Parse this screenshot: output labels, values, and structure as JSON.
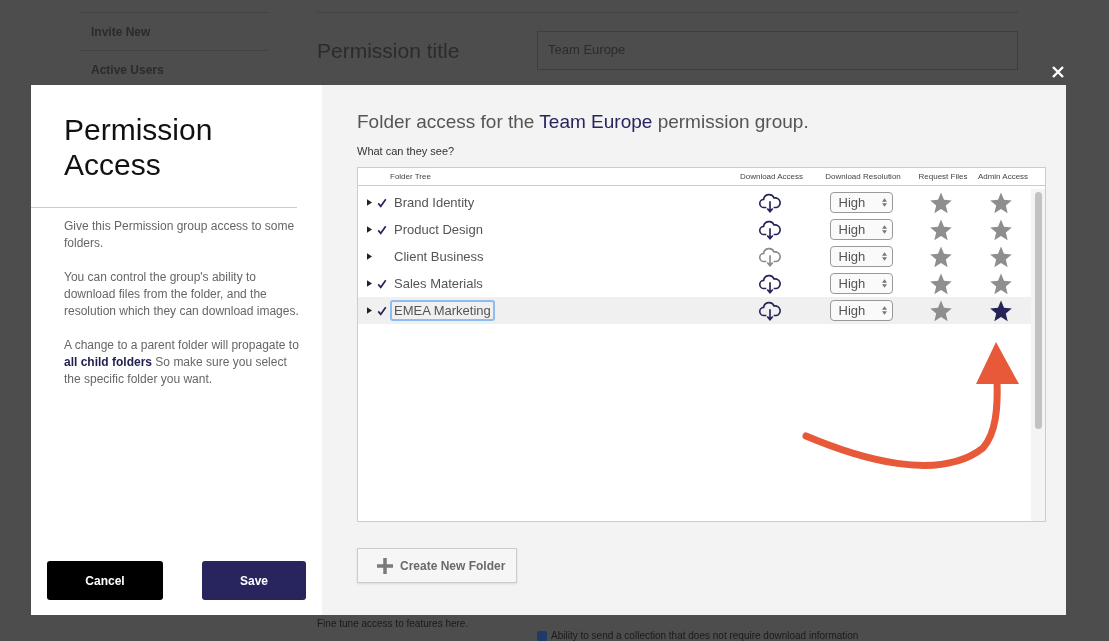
{
  "background": {
    "nav": [
      "Invite New",
      "Active Users"
    ],
    "title_label": "Permission title",
    "title_value": "Team Europe",
    "note": "Fine tune access to features here.",
    "option": {
      "label": "Ability to send a collection that does not require download information",
      "checked": true
    }
  },
  "modal": {
    "title": "Permission Access",
    "description": [
      "Give this Permission group access to some folders.",
      "You can control the group's ability to download files from the folder, and the resolution which they can download images.",
      "A change to a parent folder will propagate to **all child folders** So make sure you select the specific folder you want."
    ],
    "buttons": [
      {
        "label": "Cancel",
        "kind": "secondary"
      },
      {
        "label": "Save",
        "kind": "primary"
      }
    ],
    "heading": {
      "before": "Folder access for the",
      "group": "Team Europe",
      "after": "permission group."
    },
    "subheading": "What can they see?",
    "table": {
      "columns": [
        "Folder Tree",
        "Download Access",
        "Download Resolution",
        "Request Files",
        "Admin Access"
      ],
      "rows": [
        {
          "name": "Brand Identity",
          "checked": true,
          "download": true,
          "resolution": "High",
          "request_files": false,
          "admin_access": false,
          "selected": false
        },
        {
          "name": "Product Design",
          "checked": true,
          "download": true,
          "resolution": "High",
          "request_files": false,
          "admin_access": false,
          "selected": false
        },
        {
          "name": "Client Business",
          "checked": false,
          "download": false,
          "resolution": "High",
          "request_files": false,
          "admin_access": false,
          "selected": false
        },
        {
          "name": "Sales Materials",
          "checked": true,
          "download": true,
          "resolution": "High",
          "request_files": false,
          "admin_access": false,
          "selected": false
        },
        {
          "name": "EMEA Marketing",
          "checked": true,
          "download": true,
          "resolution": "High",
          "request_files": false,
          "admin_access": true,
          "selected": true
        }
      ]
    },
    "create_button": "Create New Folder"
  }
}
